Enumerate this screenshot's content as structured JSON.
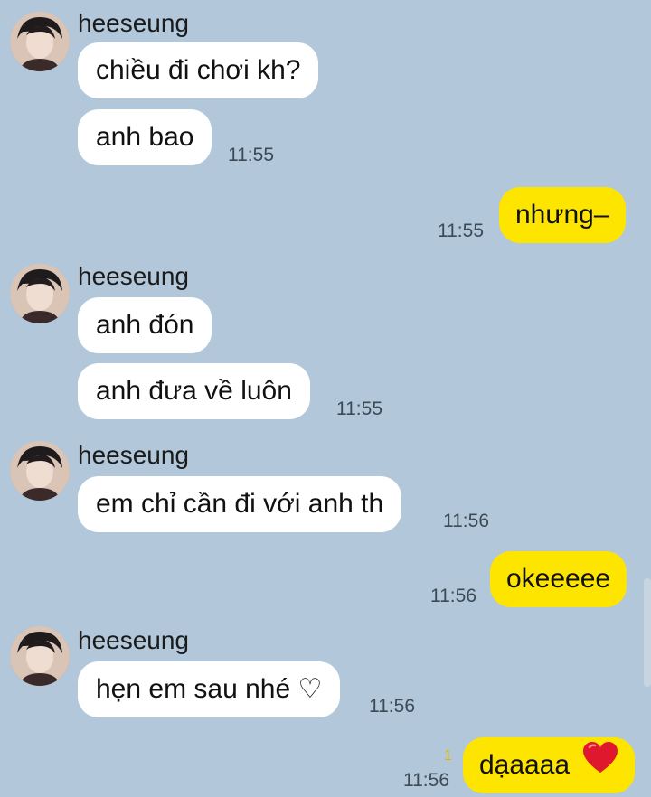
{
  "contact": {
    "name": "heeseung"
  },
  "messages": [
    {
      "sender": "heeseung",
      "text": "chiều đi chơi kh?"
    },
    {
      "text": "anh bao",
      "time": "11:55"
    },
    {
      "me": true,
      "text": "nhưng–",
      "time": "11:55"
    },
    {
      "sender": "heeseung",
      "text": "anh đón"
    },
    {
      "text": "anh đưa về luôn",
      "time": "11:55"
    },
    {
      "sender": "heeseung",
      "text": "em chỉ cần đi với anh th",
      "time": "11:56"
    },
    {
      "me": true,
      "text": "okeeeee",
      "time": "11:56"
    },
    {
      "sender": "heeseung",
      "text": "hẹn em sau nhé ♡",
      "time": "11:56"
    },
    {
      "me": true,
      "text": "dạaaaa",
      "time": "11:56",
      "unread": "1",
      "emoji": "red-heart"
    }
  ],
  "colors": {
    "background": "#b2c7da",
    "incoming_bubble": "#ffffff",
    "outgoing_bubble": "#fee500",
    "unread_count": "#d9b800"
  }
}
